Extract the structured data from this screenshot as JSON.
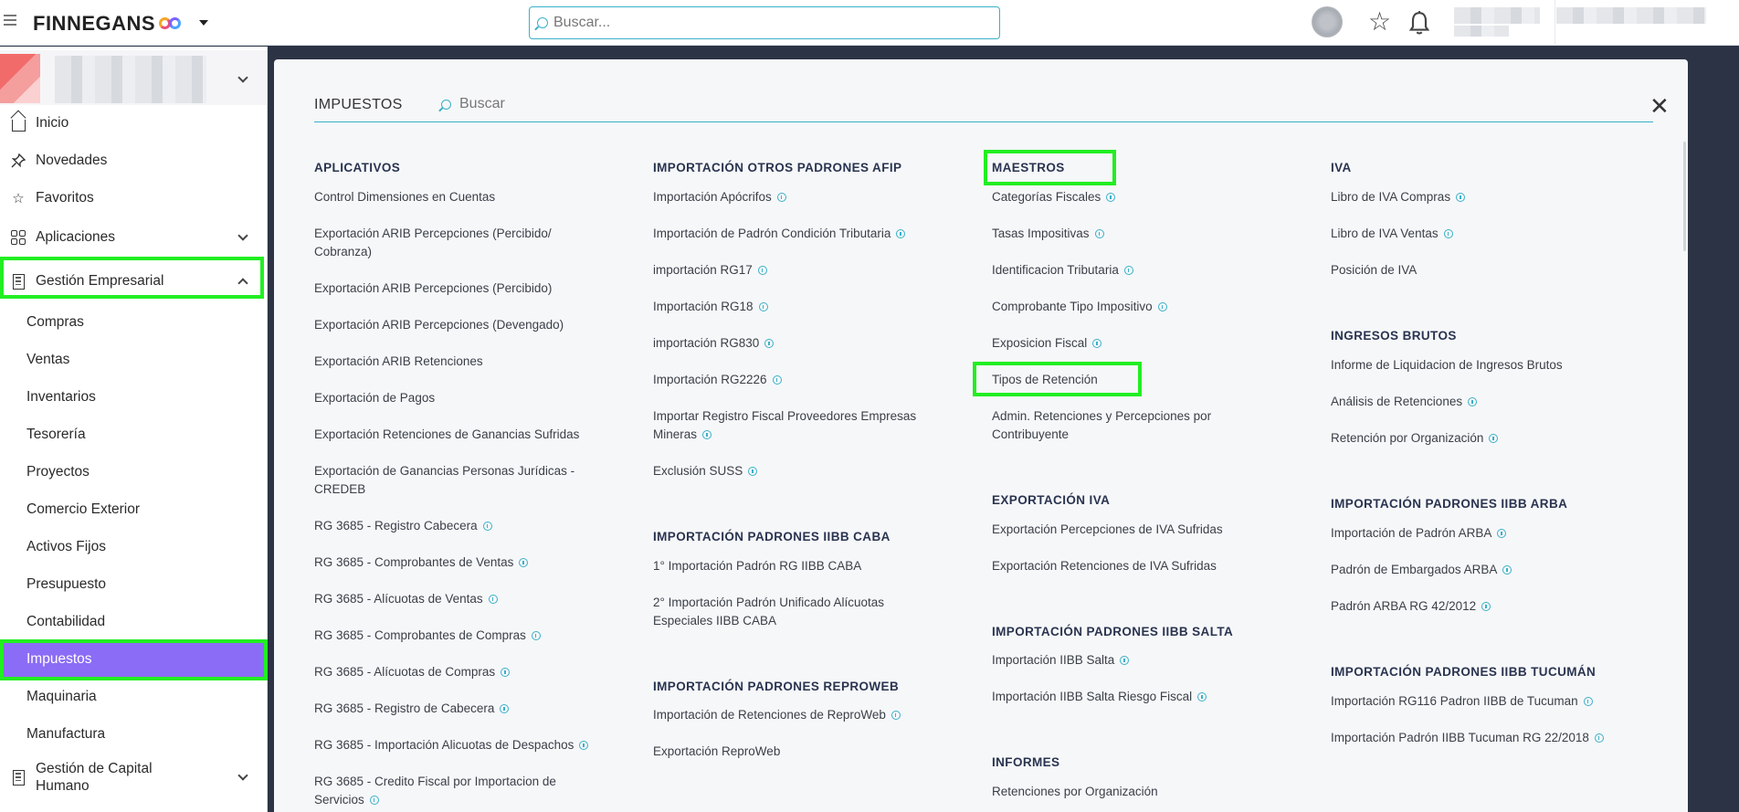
{
  "header": {
    "brand": "FINNEGANS",
    "search_placeholder": "Buscar..."
  },
  "sidebar": {
    "items": [
      {
        "label": "Inicio",
        "icon": "home-icon"
      },
      {
        "label": "Novedades",
        "icon": "pin-icon"
      },
      {
        "label": "Favoritos",
        "icon": "star-icon"
      },
      {
        "label": "Aplicaciones",
        "icon": "apps-icon"
      },
      {
        "label": "Gestión Empresarial",
        "icon": "building-icon"
      }
    ],
    "sub_items": [
      "Compras",
      "Ventas",
      "Inventarios",
      "Tesorería",
      "Proyectos",
      "Comercio Exterior",
      "Activos Fijos",
      "Presupuesto",
      "Contabilidad",
      "Impuestos",
      "Maquinaria",
      "Manufactura"
    ],
    "bottom_item": "Gestión de Capital Humano"
  },
  "panel": {
    "title": "IMPUESTOS",
    "search_placeholder": "Buscar"
  },
  "columns": [
    {
      "sections": [
        {
          "title": "APLICATIVOS",
          "links": [
            {
              "label": "Control Dimensiones en Cuentas",
              "info": false
            },
            {
              "label": "Exportación ARIB Percepciones (Percibido/ Cobranza)",
              "info": false
            },
            {
              "label": "Exportación ARIB Percepciones (Percibido)",
              "info": false
            },
            {
              "label": "Exportación ARIB Percepciones (Devengado)",
              "info": false
            },
            {
              "label": "Exportación ARIB Retenciones",
              "info": false
            },
            {
              "label": "Exportación de Pagos",
              "info": false
            },
            {
              "label": "Exportación Retenciones de Ganancias Sufridas",
              "info": false
            },
            {
              "label": "Exportación de Ganancias Personas Jurídicas - CREDEB",
              "info": false
            },
            {
              "label": "RG 3685 - Registro Cabecera",
              "info": true
            },
            {
              "label": "RG 3685 - Comprobantes de Ventas",
              "info": true
            },
            {
              "label": "RG 3685 - Alícuotas de Ventas",
              "info": true
            },
            {
              "label": "RG 3685 - Comprobantes de Compras",
              "info": true
            },
            {
              "label": "RG 3685 - Alícuotas de Compras",
              "info": true
            },
            {
              "label": "RG 3685 - Registro de Cabecera",
              "info": true
            },
            {
              "label": "RG 3685 - Importación Alicuotas de Despachos",
              "info": true
            },
            {
              "label": "RG 3685 - Credito Fiscal por Importacion de Servicios",
              "info": true
            }
          ]
        }
      ]
    },
    {
      "sections": [
        {
          "title": "IMPORTACIÓN OTROS PADRONES AFIP",
          "links": [
            {
              "label": "Importación Apócrifos",
              "info": true
            },
            {
              "label": "Importación de Padrón Condición Tributaria",
              "info": true
            },
            {
              "label": "importación RG17",
              "info": true
            },
            {
              "label": "Importación RG18",
              "info": true
            },
            {
              "label": "importación RG830",
              "info": true
            },
            {
              "label": "Importación RG2226",
              "info": true
            },
            {
              "label": "Importar Registro Fiscal Proveedores Empresas Mineras",
              "info": true
            },
            {
              "label": "Exclusión SUSS",
              "info": true
            }
          ]
        },
        {
          "title": "IMPORTACIÓN PADRONES IIBB CABA",
          "links": [
            {
              "label": "1° Importación Padrón RG IIBB CABA",
              "info": false
            },
            {
              "label": "2° Importación Padrón Unificado Alícuotas Especiales IIBB CABA",
              "info": false
            }
          ]
        },
        {
          "title": "IMPORTACIÓN PADRONES REPROWEB",
          "links": [
            {
              "label": "Importación de Retenciones de ReproWeb",
              "info": true
            },
            {
              "label": "Exportación ReproWeb",
              "info": false
            }
          ]
        }
      ]
    },
    {
      "sections": [
        {
          "title": "MAESTROS",
          "links": [
            {
              "label": "Categorías Fiscales",
              "info": true
            },
            {
              "label": "Tasas Impositivas",
              "info": true
            },
            {
              "label": "Identificacion Tributaria",
              "info": true
            },
            {
              "label": "Comprobante Tipo Impositivo",
              "info": true
            },
            {
              "label": "Exposicion Fiscal",
              "info": true
            },
            {
              "label": "Tipos de Retención",
              "info": false
            },
            {
              "label": "Admin. Retenciones y Percepciones por Contribuyente",
              "info": false
            }
          ]
        },
        {
          "title": "EXPORTACIÓN IVA",
          "links": [
            {
              "label": "Exportación Percepciones de IVA Sufridas",
              "info": false
            },
            {
              "label": "Exportación Retenciones de IVA Sufridas",
              "info": false
            }
          ]
        },
        {
          "title": "IMPORTACIÓN PADRONES IIBB SALTA",
          "links": [
            {
              "label": "Importación IIBB Salta",
              "info": true
            },
            {
              "label": "Importación IIBB Salta Riesgo Fiscal",
              "info": true
            }
          ]
        },
        {
          "title": "INFORMES",
          "links": [
            {
              "label": "Retenciones por Organización",
              "info": false
            }
          ]
        }
      ]
    },
    {
      "sections": [
        {
          "title": "IVA",
          "links": [
            {
              "label": "Libro de IVA Compras",
              "info": true
            },
            {
              "label": "Libro de IVA Ventas",
              "info": true
            },
            {
              "label": "Posición de IVA",
              "info": false
            }
          ]
        },
        {
          "title": "INGRESOS BRUTOS",
          "links": [
            {
              "label": "Informe de Liquidacion de Ingresos Brutos",
              "info": false
            },
            {
              "label": "Análisis de Retenciones",
              "info": true
            },
            {
              "label": "Retención por Organización",
              "info": true
            }
          ]
        },
        {
          "title": "IMPORTACIÓN PADRONES IIBB ARBA",
          "links": [
            {
              "label": "Importación de Padrón ARBA",
              "info": true
            },
            {
              "label": "Padrón de Embargados ARBA",
              "info": true
            },
            {
              "label": "Padrón ARBA RG 42/2012",
              "info": true
            }
          ]
        },
        {
          "title": "IMPORTACIÓN PADRONES IIBB TUCUMÁN",
          "links": [
            {
              "label": "Importación RG116 Padron IIBB de Tucuman",
              "info": true
            },
            {
              "label": "Importación Padrón IIBB Tucuman RG 22/2018",
              "info": true
            }
          ]
        }
      ]
    }
  ],
  "colors": {
    "accent": "#3ab0c8",
    "active_item": "#8b6cf6",
    "highlight": "#22ee22",
    "backdrop": "#2c3344"
  }
}
